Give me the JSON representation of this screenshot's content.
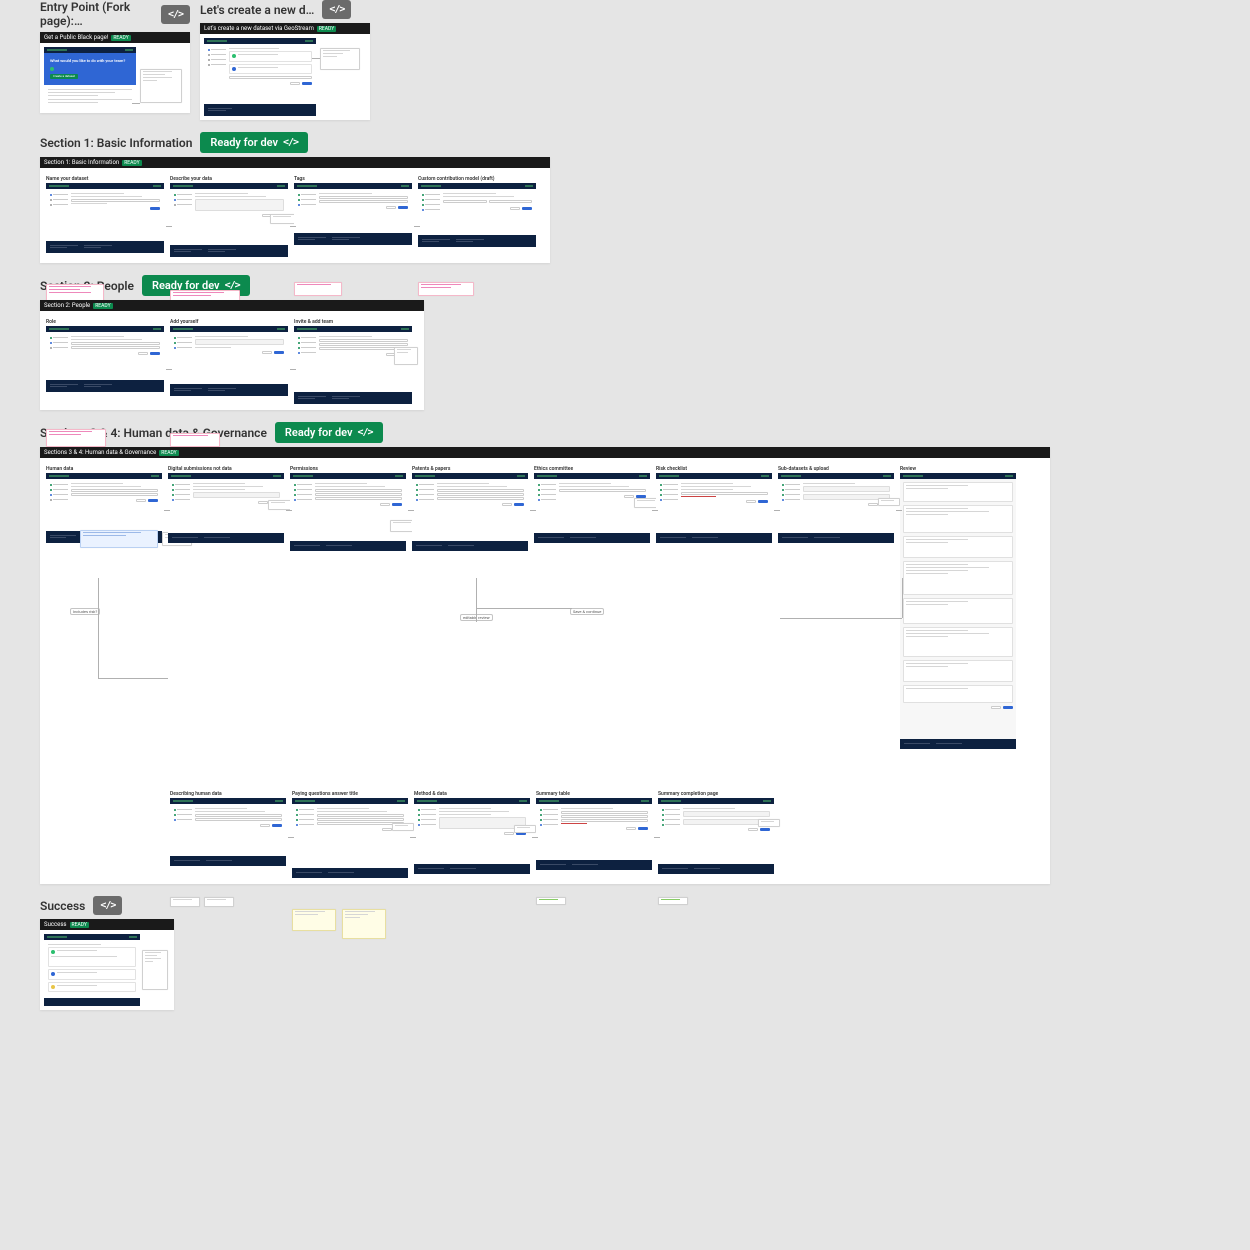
{
  "sections": {
    "entry_point": {
      "title": "Entry Point (Fork page):…"
    },
    "create_new": {
      "title": "Let's create a new d…"
    },
    "section1": {
      "title": "Section 1: Basic Information",
      "badge": "Ready for dev"
    },
    "section2": {
      "title": "Section 2: People",
      "badge": "Ready for dev"
    },
    "section34": {
      "title": "Sections 3 & 4: Human data & Governance",
      "badge": "Ready for dev"
    },
    "success": {
      "title": "Success"
    }
  },
  "frame_titles": {
    "entry_frame": "Get a Public Black page!",
    "create_frame": "Let's create a new dataset via GeoStream",
    "section1_frame": "Section 1: Basic Information",
    "section2_frame": "Section 2: People",
    "section34_frame": "Sections 3 & 4: Human data & Governance",
    "success_frame": "Success"
  },
  "hero_text": "What would you like to do with your team?",
  "hero_cta": "Create a dataset",
  "s1_labels": [
    "Name your dataset",
    "Describe your data",
    "Tags",
    "Custom contribution model (draft)"
  ],
  "s2_labels": [
    "Role",
    "Add yourself",
    "Invite & add team"
  ],
  "s34_top_labels": [
    "Human data",
    "Digital submissions not data",
    "Permissions",
    "Patents & papers",
    "Ethics committee",
    "Risk checklist",
    "Sub-datasets & upload",
    "Review"
  ],
  "s34_bottom_labels": [
    "Describing human data",
    "Paying questions answer title",
    "Method & data",
    "Summary table",
    "Summary completion page"
  ],
  "flow_pills": {
    "yes": "Includes risk?",
    "mid": "Save & continue",
    "right": "editable review"
  },
  "colors": {
    "green": "#0c8a4e",
    "navy": "#0d2140",
    "blue": "#2f66d4"
  }
}
